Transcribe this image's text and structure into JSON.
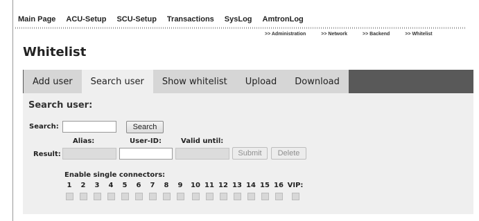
{
  "topnav": [
    "Main Page",
    "ACU-Setup",
    "SCU-Setup",
    "Transactions",
    "SysLog",
    "AmtronLog"
  ],
  "subnav": [
    ">> Administration",
    ">> Network",
    ">> Backend",
    ">> Whitelist"
  ],
  "page_title": "Whitelist",
  "tabs": [
    "Add user",
    "Search user",
    "Show whitelist",
    "Upload",
    "Download"
  ],
  "active_tab": "Search user",
  "section_title": "Search user:",
  "search": {
    "label": "Search:",
    "value": "",
    "button": "Search"
  },
  "result": {
    "label": "Result:",
    "alias_label": "Alias:",
    "userid_label": "User-ID:",
    "valid_label": "Valid until:",
    "alias_value": "",
    "userid_value": "",
    "valid_value": "",
    "submit": "Submit",
    "delete": "Delete"
  },
  "connectors": {
    "label": "Enable single connectors:",
    "items": [
      "1",
      "2",
      "3",
      "4",
      "5",
      "6",
      "7",
      "8",
      "9",
      "10",
      "11",
      "12",
      "13",
      "14",
      "15",
      "16",
      "VIP:"
    ]
  }
}
